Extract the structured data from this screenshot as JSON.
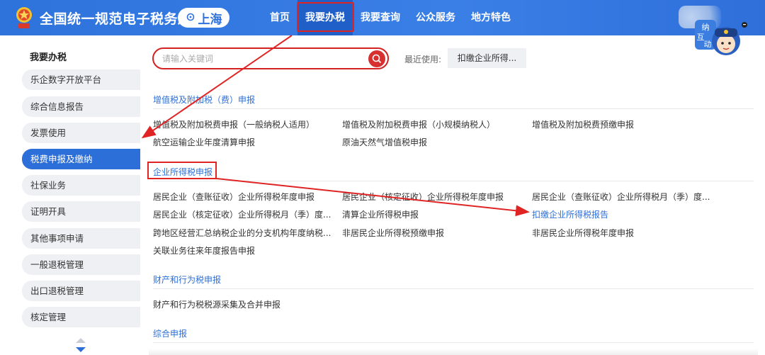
{
  "header": {
    "title": "全国统一规范电子税务局",
    "region": "上海",
    "nav": [
      "首页",
      "我要办税",
      "我要查询",
      "公众服务",
      "地方特色"
    ],
    "active_nav": "我要办税",
    "mascot_text": "纳互动"
  },
  "sidebar": {
    "title": "我要办税",
    "items": [
      "乐企数字开放平台",
      "综合信息报告",
      "发票使用",
      "税费申报及缴纳",
      "社保业务",
      "证明开具",
      "其他事项申请",
      "一般退税管理",
      "出口退税管理",
      "核定管理"
    ],
    "active_item": "税费申报及缴纳"
  },
  "search": {
    "placeholder": "请输入关键词",
    "recent_label": "最近使用:",
    "recent_chip": "扣缴企业所得..."
  },
  "sections": [
    {
      "title": "增值税及附加税（费）申报",
      "items": [
        "增值税及附加税费申报（一般纳税人适用）",
        "增值税及附加税费申报（小规模纳税人）",
        "增值税及附加税费预缴申报",
        "航空运输企业年度清算申报",
        "原油天然气增值税申报"
      ]
    },
    {
      "title": "企业所得税申报",
      "items": [
        "居民企业（查账征收）企业所得税年度申报",
        "居民企业（核定征收）企业所得税年度申报",
        "居民企业（查账征收）企业所得税月（季）度...",
        "居民企业（核定征收）企业所得税月（季）度...",
        "清算企业所得税申报",
        "扣缴企业所得税报告",
        "跨地区经营汇总纳税企业的分支机构年度纳税...",
        "非居民企业所得税预缴申报",
        "非居民企业所得税年度申报",
        "关联业务往来年度报告申报"
      ],
      "highlight_item": "扣缴企业所得税报告"
    },
    {
      "title": "财产和行为税申报",
      "items": [
        "财产和行为税税源采集及合并申报"
      ]
    },
    {
      "title": "综合申报",
      "items": []
    }
  ],
  "colors": {
    "header_blue": "#2e72dc",
    "accent_blue": "#2d6fd8",
    "annotation_red": "#e02424"
  }
}
